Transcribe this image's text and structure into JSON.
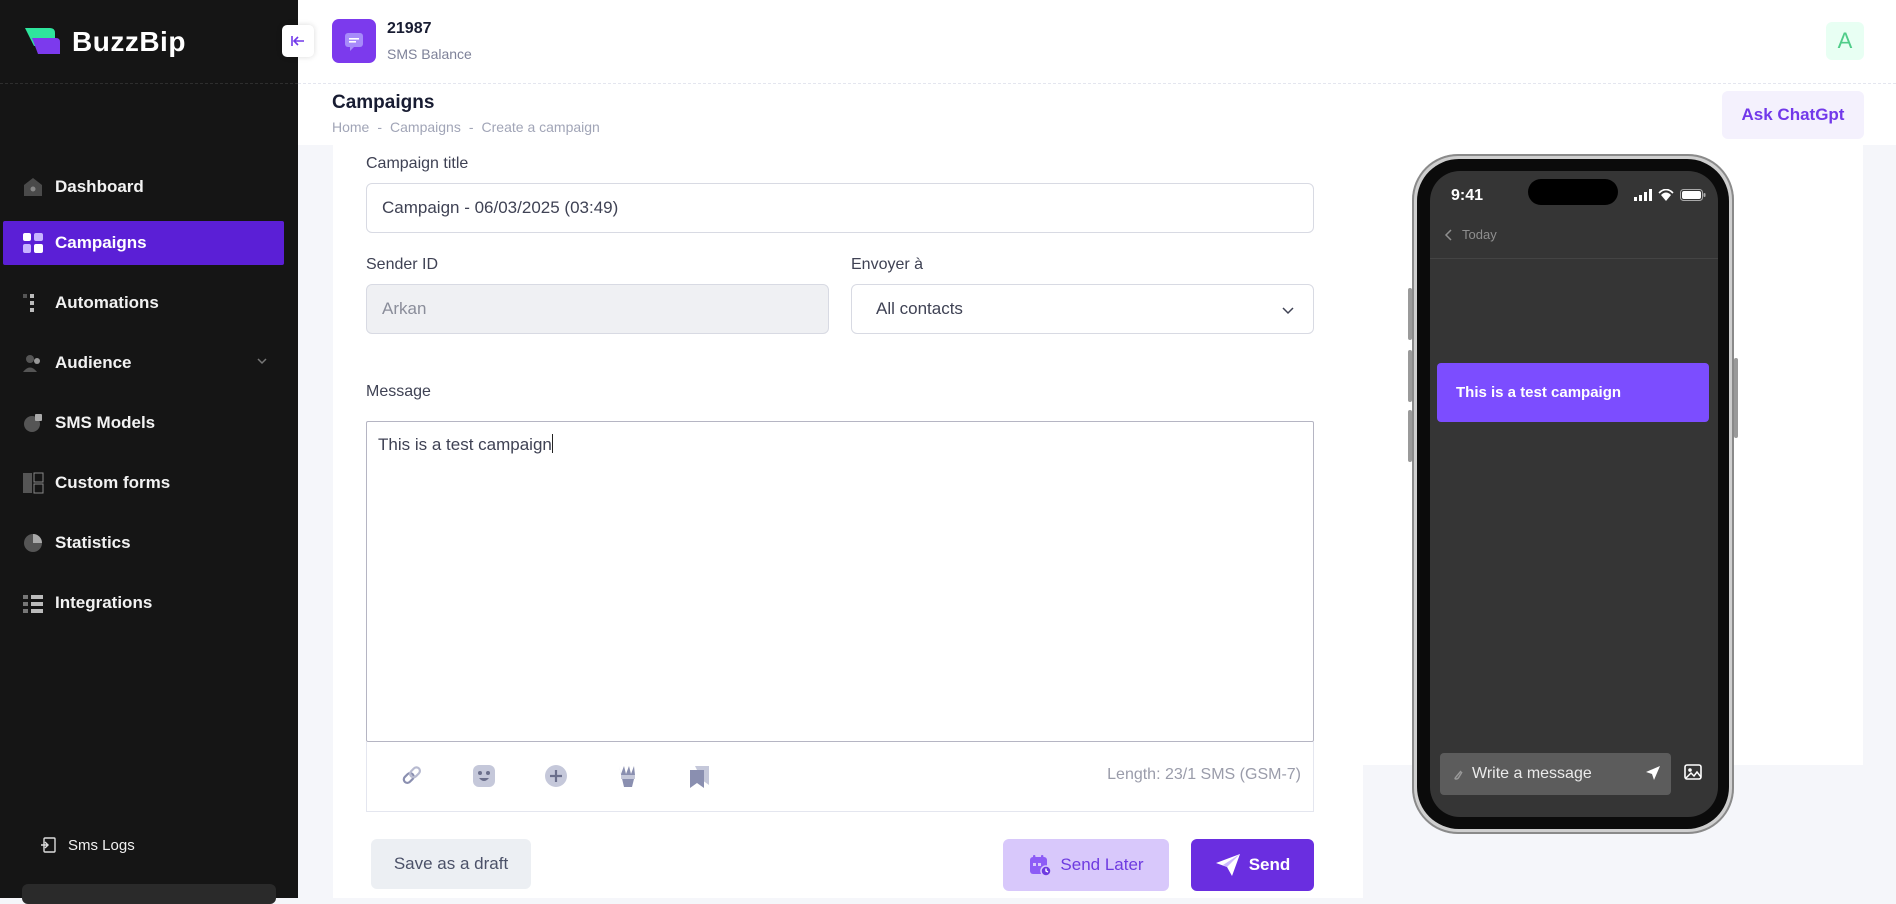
{
  "app": {
    "name": "BuzzBip"
  },
  "sidebar": {
    "items": [
      {
        "label": "Dashboard",
        "icon": "home-icon"
      },
      {
        "label": "Campaigns",
        "icon": "grid-icon",
        "active": true
      },
      {
        "label": "Automations",
        "icon": "list-icon"
      },
      {
        "label": "Audience",
        "icon": "users-icon",
        "expandable": true
      },
      {
        "label": "SMS Models",
        "icon": "template-icon"
      },
      {
        "label": "Custom forms",
        "icon": "form-icon"
      },
      {
        "label": "Statistics",
        "icon": "pie-chart-icon"
      },
      {
        "label": "Integrations",
        "icon": "integrations-icon"
      }
    ],
    "sms_logs": "Sms Logs"
  },
  "header": {
    "balance_value": "21987",
    "balance_label": "SMS Balance",
    "avatar_letter": "A",
    "page_title": "Campaigns",
    "breadcrumb": [
      "Home",
      "Campaigns",
      "Create a campaign"
    ],
    "breadcrumb_sep": "-",
    "ask_button": "Ask ChatGpt"
  },
  "form": {
    "title_label": "Campaign title",
    "title_value": "Campaign - 06/03/2025 (03:49)",
    "sender_label": "Sender ID",
    "sender_value": "Arkan",
    "send_to_label": "Envoyer à",
    "send_to_value": "All contacts",
    "message_label": "Message",
    "message_value": "This is a test campaign",
    "length_text": "Length: 23/1 SMS (GSM-7)",
    "tools": [
      "link-icon",
      "emoji-icon",
      "plus-circle-icon",
      "magic-icon",
      "bookmark-icon"
    ]
  },
  "actions": {
    "draft": "Save as a draft",
    "send_later": "Send Later",
    "send": "Send"
  },
  "phone": {
    "time": "9:41",
    "nav_label": "Today",
    "bubble_text": "This is a test campaign",
    "compose_placeholder": "Write a message"
  },
  "colors": {
    "accent": "#6a2ee0",
    "sidebar_bg": "#151515",
    "active_nav": "#5b1fd6",
    "bubble": "#7c4dff"
  }
}
